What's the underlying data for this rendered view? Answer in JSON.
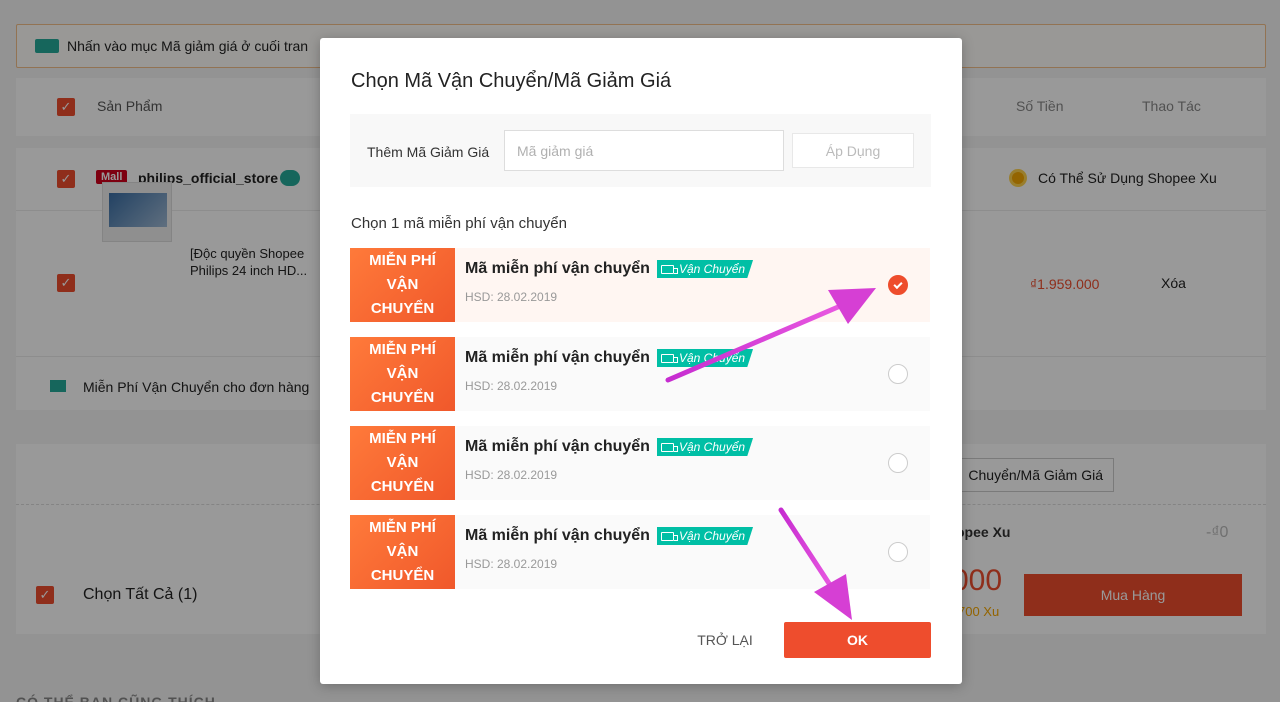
{
  "background": {
    "notice": "Nhấn vào mục Mã giảm giá ở cuối tran",
    "header": {
      "product": "Sản Phẩm",
      "amount": "Số Tiền",
      "action": "Thao Tác"
    },
    "shop": {
      "mall_badge": "Mall",
      "name": "philips_official_store",
      "xu_note": "Có Thể Sử Dụng Shopee Xu"
    },
    "product": {
      "title_line1": "[Độc quyền Shopee",
      "title_line2": "Philips 24 inch HD...",
      "price": "₫1.959.000",
      "delete": "Xóa"
    },
    "free_ship": "Miễn Phí Vận Chuyển cho đơn hàng",
    "footer": {
      "voucher_btn": "Chuyển/Mã Giảm Giá",
      "xu_label": "opee Xu",
      "xu_value": "-₫0",
      "select_all": "Chọn Tất Cả (1)",
      "big_price": "000",
      "xu_price": "700 Xu",
      "buy": "Mua Hàng"
    },
    "bottom_section": "CÓ THỂ BẠN CŨNG THÍCH"
  },
  "modal": {
    "title": "Chọn Mã Vận Chuyển/Mã Giảm Giá",
    "add_label": "Thêm Mã Giảm Giá",
    "input_placeholder": "Mã giảm giá",
    "apply": "Áp Dụng",
    "section_label": "Chọn 1 mã miễn phí vận chuyển",
    "vouchers": [
      {
        "stub": "MIỄN PHÍ VẬN CHUYỂN",
        "title": "Mã miễn phí vận chuyển",
        "tag": "Vận Chuyển",
        "expiry": "HSD: 28.02.2019",
        "selected": true
      },
      {
        "stub": "MIỄN PHÍ VẬN CHUYỂN",
        "title": "Mã miễn phí vận chuyển",
        "tag": "Vận Chuyển",
        "expiry": "HSD: 28.02.2019",
        "selected": false
      },
      {
        "stub": "MIỄN PHÍ VẬN CHUYỂN",
        "title": "Mã miễn phí vận chuyển",
        "tag": "Vận Chuyển",
        "expiry": "HSD: 28.02.2019",
        "selected": false
      },
      {
        "stub": "MIỄN PHÍ VẬN CHUYỂN",
        "title": "Mã miễn phí vận chuyển",
        "tag": "Vận Chuyển",
        "expiry": "HSD: 28.02.2019",
        "selected": false
      }
    ],
    "back": "TRỞ LẠI",
    "ok": "OK"
  },
  "colors": {
    "accent": "#ee4d2d",
    "tag": "#00bfa5",
    "annotation_arrow": "#e040d0"
  }
}
